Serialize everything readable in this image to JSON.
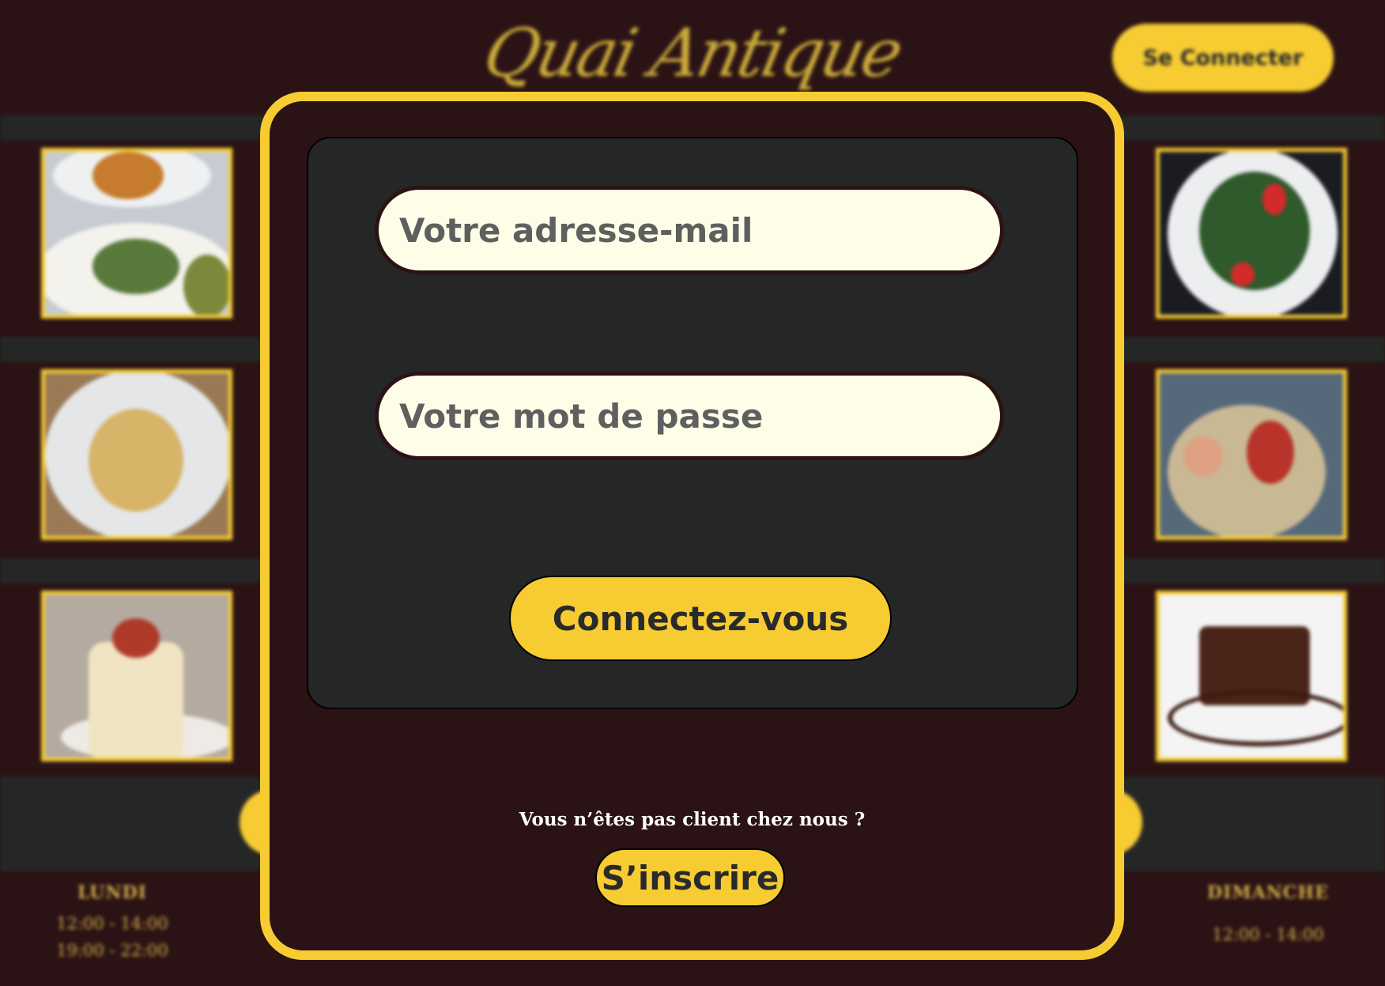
{
  "header": {
    "logo_text": "Quai Antique",
    "connect_label": "Se Connecter"
  },
  "schedule": [
    {
      "day": "LUNDI",
      "slots": [
        "12:00 - 14:00",
        "19:00 - 22:00"
      ]
    },
    {
      "day": "DIMANCHE",
      "slots": [
        "12:00 - 14:00"
      ]
    }
  ],
  "login_modal": {
    "email_placeholder": "Votre adresse-mail",
    "password_placeholder": "Votre mot de passe",
    "submit_label": "Connectez-vous",
    "not_client_text": "Vous n’êtes pas client chez nous ?",
    "signup_label": "S’inscrire"
  },
  "colors": {
    "accent": "#f6cc32",
    "background": "#2b1315",
    "panel": "#252727",
    "field": "#fefee8"
  }
}
